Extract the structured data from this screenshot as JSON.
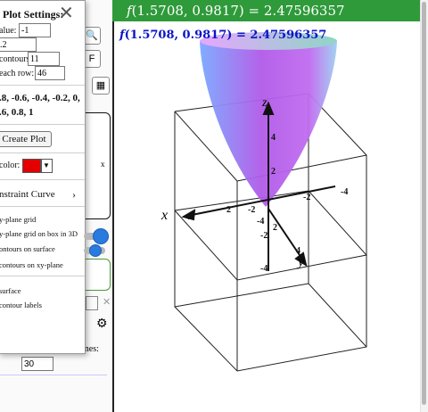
{
  "header": {
    "fn": "f",
    "expr": "(1.5708, 0.9817) = 2.47596357"
  },
  "plot_label": {
    "fn": "f",
    "expr": "(1.5708, 0.9817) = 2.47596357"
  },
  "axes": {
    "x": "x",
    "y": "y",
    "z": "z",
    "ticks": [
      "2",
      "4",
      "-2",
      "-4",
      "2",
      "4",
      "-2",
      "-4",
      "2",
      "4",
      "-2",
      "-4"
    ]
  },
  "popup": {
    "title": "Plot Settings:",
    "close": "✕",
    "min_label": "alue:",
    "min_value": "-1",
    "step_value": ".2",
    "contours_label": "contours:",
    "contours_value": "11",
    "each_row_label": " each row:",
    "each_row_value": "46",
    "levels_line1": ".8, -0.6, -0.4, -0.2, 0,",
    "levels_line2": ".6, 0.8, 1",
    "create_plot": "Create Plot",
    "color_label": "color:",
    "constraint": "nstraint Curve",
    "grid_xy": "y-plane grid",
    "grid_box": "y-plane grid on box in 3D",
    "contours_surface": "ontours on surface",
    "contours_xy": "contours on xy-plane",
    "surface": " surface",
    "contour_labels": " contour labels"
  },
  "left": {
    "bottom_label": "ines:",
    "bottom_value": "30",
    "btn_f": "F",
    "x_mark": "x",
    "gear": "⚙"
  },
  "colors": {
    "header_bg": "#2f9a3a",
    "plot_label": "#0a14c8",
    "swatch": "#e40000",
    "toggle": "#2a7be0"
  }
}
